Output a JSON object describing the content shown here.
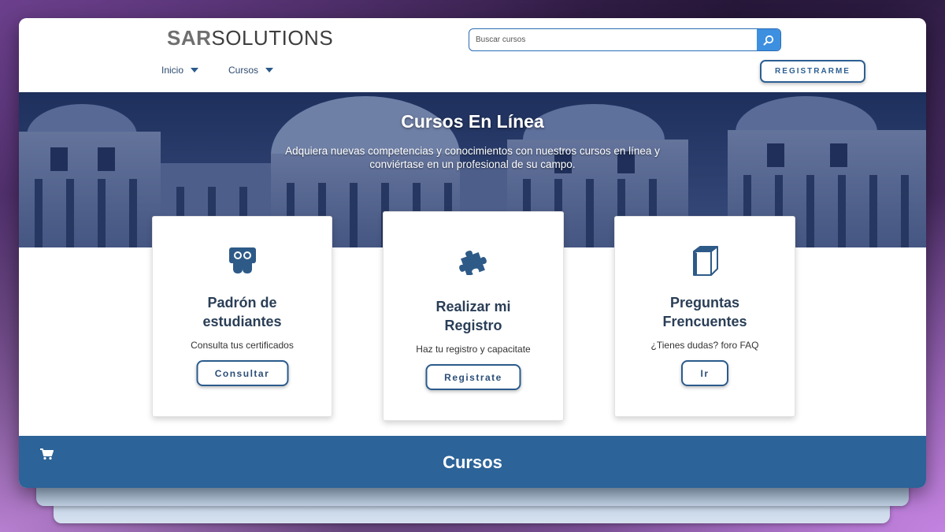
{
  "header": {
    "logo_bold": "SAR",
    "logo_rest": "SOLUTIONS",
    "search_placeholder": "Buscar cursos",
    "nav": [
      {
        "label": "Inicio"
      },
      {
        "label": "Cursos"
      }
    ],
    "register_label": "REGISTRARME"
  },
  "hero": {
    "title": "Cursos En Línea",
    "subtitle": "Adquiera nuevas competencias y conocimientos con nuestros cursos en línea y conviértase en un profesional de su campo."
  },
  "cards": [
    {
      "icon": "slideshare-people-icon",
      "title": "Padrón de estudiantes",
      "description": "Consulta tus certificados",
      "button": "Consultar"
    },
    {
      "icon": "puzzle-piece-icon",
      "title": "Realizar mi Registro",
      "description": "Haz tu registro y capacitate",
      "button": "Registrate"
    },
    {
      "icon": "cube-icon",
      "title": "Preguntas Frencuentes",
      "description": "¿Tienes dudas? foro FAQ",
      "button": "Ir"
    }
  ],
  "bottom": {
    "title": "Cursos",
    "cart_icon": "shopping-cart-icon"
  },
  "colors": {
    "primary": "#2c6398",
    "accent_button": "#3d8fe0",
    "icon_blue": "#2e5a88"
  }
}
